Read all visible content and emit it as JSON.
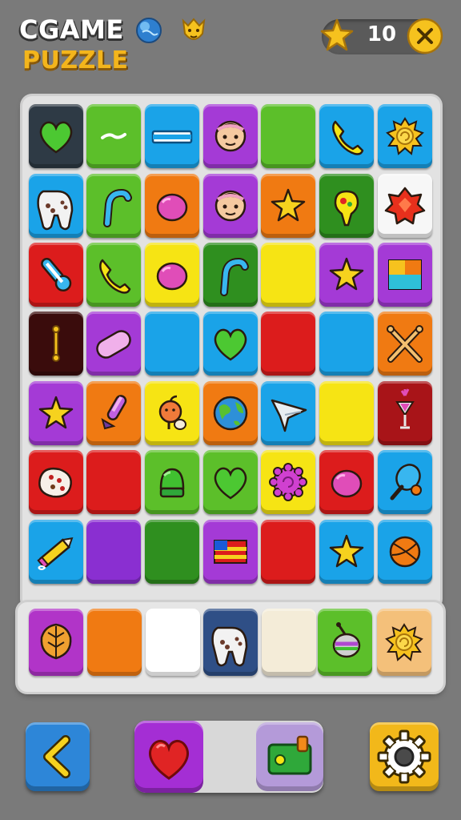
{
  "header": {
    "title_line1": "CGAME",
    "title_line2": "PUZZLE",
    "score": "10"
  },
  "colors": {
    "background": "#7a7a7a",
    "title_white": "#ffffff",
    "title_gold": "#f3b51c",
    "board_bg": "#e2e2e2",
    "tile_dark": "#2e3a45",
    "tile_green": "#5cbf2a",
    "tile_blue": "#1aa3e8",
    "tile_purple": "#a43ad6",
    "tile_orange": "#f07a12",
    "tile_yellow": "#f6e414",
    "tile_red": "#dc1c1c",
    "tile_maroon": "#3a0c0c",
    "tile_white": "#f7f7f7",
    "tile_cream": "#f4ecd8",
    "tile_peach": "#f4c07a"
  },
  "board": {
    "rows": [
      [
        {
          "color": "#2e3a45",
          "icon": "heart-icon"
        },
        {
          "color": "#5cbf2a",
          "icon": "dash-icon"
        },
        {
          "color": "#1aa3e8",
          "icon": "bar-icon"
        },
        {
          "color": "#a43ad6",
          "icon": "face-icon"
        },
        {
          "color": "#5cbf2a",
          "icon": "none"
        },
        {
          "color": "#1aa3e8",
          "icon": "phone-icon"
        },
        {
          "color": "#1aa3e8",
          "icon": "sun-icon"
        }
      ],
      [
        {
          "color": "#1aa3e8",
          "icon": "gamepad-icon"
        },
        {
          "color": "#5cbf2a",
          "icon": "hook-icon"
        },
        {
          "color": "#f07a12",
          "icon": "candy-icon"
        },
        {
          "color": "#a43ad6",
          "icon": "face-icon"
        },
        {
          "color": "#f07a12",
          "icon": "star-icon"
        },
        {
          "color": "#2f8f1f",
          "icon": "bulb-icon"
        },
        {
          "color": "#f7f7f7",
          "icon": "gem-icon"
        }
      ],
      [
        {
          "color": "#dc1c1c",
          "icon": "thermometer-icon"
        },
        {
          "color": "#5cbf2a",
          "icon": "phone-icon"
        },
        {
          "color": "#f6e414",
          "icon": "candy-icon"
        },
        {
          "color": "#2f8f1f",
          "icon": "hook-icon"
        },
        {
          "color": "#f6e414",
          "icon": "none"
        },
        {
          "color": "#a43ad6",
          "icon": "star-icon"
        },
        {
          "color": "#a43ad6",
          "icon": "squares-icon"
        }
      ],
      [
        {
          "color": "#3a0c0c",
          "icon": "pin-icon"
        },
        {
          "color": "#a43ad6",
          "icon": "capsule-icon"
        },
        {
          "color": "#1aa3e8",
          "icon": "none"
        },
        {
          "color": "#1aa3e8",
          "icon": "heart-icon"
        },
        {
          "color": "#dc1c1c",
          "icon": "none"
        },
        {
          "color": "#1aa3e8",
          "icon": "none"
        },
        {
          "color": "#f07a12",
          "icon": "cross-icon"
        }
      ],
      [
        {
          "color": "#a43ad6",
          "icon": "star-icon"
        },
        {
          "color": "#f07a12",
          "icon": "microphone-icon"
        },
        {
          "color": "#f6e414",
          "icon": "apple-icon"
        },
        {
          "color": "#f07a12",
          "icon": "globe-icon"
        },
        {
          "color": "#1aa3e8",
          "icon": "plane-icon"
        },
        {
          "color": "#f6e414",
          "icon": "none"
        },
        {
          "color": "#a81418",
          "icon": "cocktail-icon"
        }
      ],
      [
        {
          "color": "#dc1c1c",
          "icon": "dice-icon"
        },
        {
          "color": "#dc1c1c",
          "icon": "none"
        },
        {
          "color": "#5cbf2a",
          "icon": "bell-icon"
        },
        {
          "color": "#5cbf2a",
          "icon": "heart-icon"
        },
        {
          "color": "#f6e414",
          "icon": "flower-icon"
        },
        {
          "color": "#dc1c1c",
          "icon": "candy-icon"
        },
        {
          "color": "#1aa3e8",
          "icon": "paddle-icon"
        }
      ],
      [
        {
          "color": "#1aa3e8",
          "icon": "pencil-icon"
        },
        {
          "color": "#8a2fd1",
          "icon": "none"
        },
        {
          "color": "#2f8f1f",
          "icon": "none"
        },
        {
          "color": "#a43ad6",
          "icon": "flag-icon"
        },
        {
          "color": "#dc1c1c",
          "icon": "none"
        },
        {
          "color": "#1aa3e8",
          "icon": "star-icon"
        },
        {
          "color": "#1aa3e8",
          "icon": "ball-icon"
        }
      ]
    ]
  },
  "tray": {
    "slots": [
      {
        "color": "#b134c8",
        "icon": "leaf-icon"
      },
      {
        "color": "#f07a12",
        "icon": "none"
      },
      {
        "color": "#ffffff",
        "icon": "none"
      },
      {
        "color": "#2f4f86",
        "icon": "gamepad-icon"
      },
      {
        "color": "#f4ecd8",
        "icon": "none"
      },
      {
        "color": "#5cbf2a",
        "icon": "top-icon"
      },
      {
        "color": "#f4c07a",
        "icon": "sun-icon"
      }
    ]
  },
  "bottom": {
    "back_icon": "chevron-left-icon",
    "heart_icon": "heart-icon",
    "gift_icon": "gift-icon",
    "settings_icon": "gear-icon"
  }
}
